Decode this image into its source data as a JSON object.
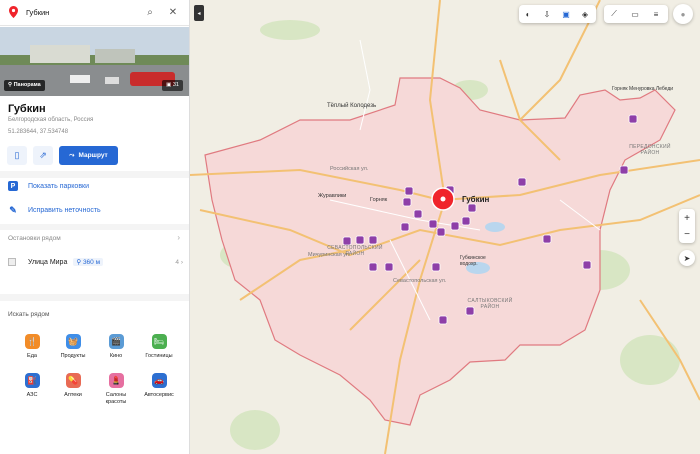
{
  "search": {
    "value": "Губкин"
  },
  "place": {
    "panorama_label": "Панорама",
    "photo_count": "31",
    "title": "Губкин",
    "region": "Белгородская область, Россия",
    "coords": "51.283644, 37.534748",
    "route_label": "Маршрут"
  },
  "actions": {
    "parking": "Показать парковки",
    "fix": "Исправить неточность"
  },
  "stops": {
    "header": "Остановки рядом",
    "name": "Улица Мира",
    "distance": "360 м",
    "count": "4"
  },
  "nearby": {
    "header": "Искать рядом",
    "categories": [
      {
        "label": "Еда",
        "color": "#f28c28",
        "icon": "fork-knife-icon",
        "glyph": "🍴"
      },
      {
        "label": "Продукты",
        "color": "#3f8ee8",
        "icon": "basket-icon",
        "glyph": "🧺"
      },
      {
        "label": "Кино",
        "color": "#5b9bd5",
        "icon": "film-icon",
        "glyph": "🎬"
      },
      {
        "label": "Гостиницы",
        "color": "#4caf50",
        "icon": "bed-icon",
        "glyph": "🛏"
      },
      {
        "label": "АЗС",
        "color": "#2d6fd1",
        "icon": "fuel-icon",
        "glyph": "⛽"
      },
      {
        "label": "Аптеки",
        "color": "#e86a54",
        "icon": "pill-icon",
        "glyph": "💊"
      },
      {
        "label": "Салоны красоты",
        "color": "#e66fa0",
        "icon": "lips-icon",
        "glyph": "💄"
      },
      {
        "label": "Автосервис",
        "color": "#2d6fd1",
        "icon": "car-icon",
        "glyph": "🚗"
      }
    ]
  },
  "map": {
    "city_label": "Губкин",
    "labels": [
      {
        "text": "Тёплый Колодезь"
      },
      {
        "text": "Журавлики"
      },
      {
        "text": "Горняк"
      },
      {
        "text": "Горняк Менуровка Лебеди"
      },
      {
        "text": "Российская ул."
      },
      {
        "text": "Мичуринская ул."
      },
      {
        "text": "Севастопольская ул."
      },
      {
        "text": "Губкинское водохр."
      }
    ],
    "district_labels": [
      "СЕВАСТОПОЛЬСКИЙ РАЙОН",
      "САЛТЫКОВСКИЙ РАЙОН",
      "ПЕРЕДОНСКИЙ РАЙОН"
    ],
    "colors": {
      "boundary": "#e07a80",
      "fill": "#f6d9d8",
      "poi": "#8e3fa8",
      "marker": "#f0242b",
      "road": "#f3c173"
    }
  }
}
